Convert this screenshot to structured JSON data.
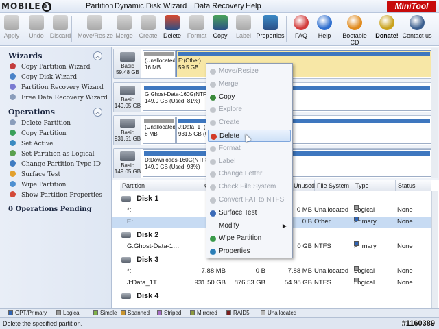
{
  "watermark": "MOBILE01",
  "menubar": {
    "items": [
      "Partition",
      "Dynamic Disk",
      "Wizard",
      "Data Recovery",
      "Help"
    ],
    "brand": "MiniTool"
  },
  "toolbar": {
    "left": [
      {
        "label": "Apply",
        "icon": "apply-icon",
        "enabled": false
      },
      {
        "label": "Undo",
        "icon": "undo-icon",
        "enabled": false
      },
      {
        "label": "Discard",
        "icon": "discard-icon",
        "enabled": false
      },
      {
        "label": "Move/Resize",
        "icon": "move-resize-icon",
        "enabled": false
      },
      {
        "label": "Merge",
        "icon": "merge-icon",
        "enabled": false
      },
      {
        "label": "Create",
        "icon": "create-icon",
        "enabled": false
      },
      {
        "label": "Delete",
        "icon": "delete-icon",
        "enabled": true
      },
      {
        "label": "Format",
        "icon": "format-icon",
        "enabled": false
      },
      {
        "label": "Copy",
        "icon": "copy-icon",
        "enabled": true
      },
      {
        "label": "Label",
        "icon": "label-icon",
        "enabled": false
      },
      {
        "label": "Properties",
        "icon": "properties-icon",
        "enabled": true
      }
    ],
    "right": [
      {
        "label": "FAQ",
        "icon": "faq-icon"
      },
      {
        "label": "Help",
        "icon": "help-icon"
      },
      {
        "label": "Bootable CD",
        "icon": "bootable-cd-icon"
      },
      {
        "label": "Donate!",
        "icon": "donate-icon"
      },
      {
        "label": "Contact us",
        "icon": "contact-icon"
      }
    ]
  },
  "sidebar": {
    "wizards_title": "Wizards",
    "wizards": [
      "Copy Partition Wizard",
      "Copy Disk Wizard",
      "Partition Recovery Wizard",
      "Free Data Recovery Wizard"
    ],
    "operations_title": "Operations",
    "operations": [
      "Delete Partition",
      "Copy Partition",
      "Set Active",
      "Set Partition as Logical",
      "Change Partition Type ID",
      "Surface Test",
      "Wipe Partition",
      "Show Partition Properties"
    ],
    "pending": "0 Operations Pending"
  },
  "diskmap": [
    {
      "type": "Basic",
      "size": "59.48 GB",
      "parts": [
        {
          "name": "(Unallocated)",
          "size": "16 MB",
          "kind": "unalloc"
        },
        {
          "name": "E:(Other)",
          "size": "59.5 GB",
          "kind": "primary",
          "selected": true
        }
      ]
    },
    {
      "type": "Basic",
      "size": "149.05 GB",
      "parts": [
        {
          "name": "G:Ghost-Data-160G(NTFS)",
          "size": "149.0 GB (Used: 81%)",
          "kind": "primary"
        }
      ]
    },
    {
      "type": "Basic",
      "size": "931.51 GB",
      "parts": [
        {
          "name": "(Unallocated)",
          "size": "8 MB",
          "kind": "unalloc"
        },
        {
          "name": "J:Data_1T(NTFS)",
          "size": "931.5 GB (Used: 8%)",
          "kind": "primary"
        }
      ]
    },
    {
      "type": "Basic",
      "size": "149.05 GB",
      "parts": [
        {
          "name": "D:Downloads-160G(NTFS)",
          "size": "149.0 GB (Used: 93%)",
          "kind": "primary"
        }
      ]
    }
  ],
  "table": {
    "headers": [
      "Partition",
      "C",
      "Unused",
      "File System",
      "Type",
      "Status"
    ],
    "rows": [
      {
        "kind": "disk",
        "label": "Disk 1"
      },
      {
        "kind": "part",
        "partition": "*:",
        "capacity": "16.0",
        "used": "",
        "unused": "0 MB",
        "fs": "Unallocated",
        "type": "Logical",
        "status": "None",
        "color": "#9a9a9a"
      },
      {
        "kind": "part",
        "partition": "E:",
        "capacity": "59.",
        "used": "",
        "unused": "0 B",
        "fs": "Other",
        "type": "Primary",
        "status": "None",
        "color": "#2f64b5",
        "selected": true
      },
      {
        "kind": "disk",
        "label": "Disk 2"
      },
      {
        "kind": "part",
        "partition": "G:Ghost-Data-1…",
        "capacity": "149.",
        "used": "",
        "unused": "0 GB",
        "fs": "NTFS",
        "type": "Primary",
        "status": "None",
        "color": "#2f64b5"
      },
      {
        "kind": "disk",
        "label": "Disk 3"
      },
      {
        "kind": "part",
        "partition": "*:",
        "capacity": "7.88 MB",
        "used": "0 B",
        "unused": "7.88 MB",
        "fs": "Unallocated",
        "type": "Logical",
        "status": "None",
        "color": "#9a9a9a"
      },
      {
        "kind": "part",
        "partition": "J:Data_1T",
        "capacity": "931.50 GB",
        "used": "876.53 GB",
        "unused": "54.98 GB",
        "fs": "NTFS",
        "type": "Logical",
        "status": "None",
        "color": "#9a9a9a"
      },
      {
        "kind": "disk",
        "label": "Disk 4"
      }
    ]
  },
  "context_menu": [
    {
      "label": "Move/Resize",
      "enabled": false,
      "icon": "move-resize-icon"
    },
    {
      "label": "Merge",
      "enabled": false,
      "icon": "merge-icon"
    },
    {
      "label": "Copy",
      "enabled": true,
      "icon": "copy-icon",
      "color": "#3a8a3a"
    },
    {
      "label": "Explore",
      "enabled": false,
      "icon": "explore-icon"
    },
    {
      "label": "Create",
      "enabled": false,
      "icon": "create-icon"
    },
    {
      "label": "Delete",
      "enabled": true,
      "icon": "delete-icon",
      "color": "#d23b2a",
      "highlighted": true
    },
    {
      "label": "Format",
      "enabled": false,
      "icon": "format-icon"
    },
    {
      "label": "Label",
      "enabled": false,
      "icon": "label-icon"
    },
    {
      "label": "Change Letter",
      "enabled": false,
      "icon": "change-letter-icon"
    },
    {
      "label": "Check File System",
      "enabled": false,
      "icon": "check-fs-icon"
    },
    {
      "label": "Convert FAT to NTFS",
      "enabled": false,
      "icon": "convert-icon"
    },
    {
      "label": "Surface Test",
      "enabled": true,
      "icon": "surface-test-icon",
      "color": "#3b6bb8"
    },
    {
      "label": "Modify",
      "enabled": true,
      "icon": "",
      "submenu": true
    },
    {
      "label": "Wipe Partition",
      "enabled": true,
      "icon": "wipe-icon",
      "color": "#3a9a4a"
    },
    {
      "label": "Properties",
      "enabled": true,
      "icon": "properties-icon",
      "color": "#2c7fb8"
    }
  ],
  "legend": [
    {
      "label": "GPT/Primary",
      "color": "#2f64b5"
    },
    {
      "label": "Logical",
      "color": "#9a9a9a"
    },
    {
      "label": "Simple",
      "color": "#7fb24a"
    },
    {
      "label": "Spanned",
      "color": "#c9952f"
    },
    {
      "label": "Striped",
      "color": "#a76fc7"
    },
    {
      "label": "Mirrored",
      "color": "#8d9a3e"
    },
    {
      "label": "RAID5",
      "color": "#7a1e1e"
    },
    {
      "label": "Unallocated",
      "color": "#b9b9b9"
    }
  ],
  "status": {
    "text": "Delete the specified partition.",
    "stamp": "#1160389"
  }
}
